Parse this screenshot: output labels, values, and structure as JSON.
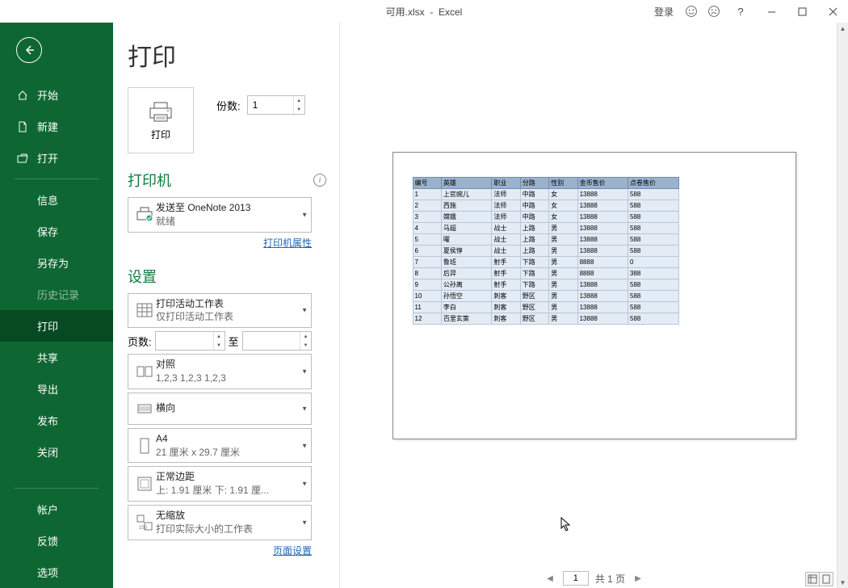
{
  "titlebar": {
    "filename": "可用.xlsx",
    "app": "Excel",
    "login": "登录",
    "help": "?"
  },
  "sidebar": {
    "start": "开始",
    "new": "新建",
    "open": "打开",
    "info": "信息",
    "save": "保存",
    "saveas": "另存为",
    "history": "历史记录",
    "print": "打印",
    "share": "共享",
    "export": "导出",
    "publish": "发布",
    "close": "关闭",
    "account": "帐户",
    "feedback": "反馈",
    "options": "选项"
  },
  "page": {
    "title": "打印",
    "copies_label": "份数:",
    "copies_value": "1",
    "print_button": "打印"
  },
  "printer": {
    "header": "打印机",
    "name": "发送至 OneNote 2013",
    "status": "就绪",
    "properties": "打印机属性"
  },
  "settings": {
    "header": "设置",
    "what": {
      "top": "打印活动工作表",
      "bot": "仅打印活动工作表"
    },
    "pages_label": "页数:",
    "pages_to": "至",
    "collate": {
      "top": "对照",
      "bot": "1,2,3    1,2,3    1,2,3"
    },
    "orientation": {
      "top": "横向"
    },
    "paper": {
      "top": "A4",
      "bot": "21 厘米 x 29.7 厘米"
    },
    "margins": {
      "top": "正常边距",
      "bot": "上: 1.91 厘米 下: 1.91 厘..."
    },
    "scaling": {
      "top": "无缩放",
      "bot": "打印实际大小的工作表"
    },
    "page_setup": "页面设置"
  },
  "preview": {
    "headers": [
      "编号",
      "英雄",
      "职业",
      "分路",
      "性别",
      "金币售价",
      "点卷售价"
    ],
    "rows": [
      [
        "1",
        "上官婉儿",
        "法师",
        "中路",
        "女",
        "13888",
        "588"
      ],
      [
        "2",
        "西施",
        "法师",
        "中路",
        "女",
        "13888",
        "588"
      ],
      [
        "3",
        "嫦娥",
        "法师",
        "中路",
        "女",
        "13888",
        "588"
      ],
      [
        "4",
        "马超",
        "战士",
        "上路",
        "男",
        "13888",
        "588"
      ],
      [
        "5",
        "曜",
        "战士",
        "上路",
        "男",
        "13888",
        "588"
      ],
      [
        "6",
        "夏侯惇",
        "战士",
        "上路",
        "男",
        "13888",
        "588"
      ],
      [
        "7",
        "鲁班",
        "射手",
        "下路",
        "男",
        "8888",
        "0"
      ],
      [
        "8",
        "后羿",
        "射手",
        "下路",
        "男",
        "8888",
        "388"
      ],
      [
        "9",
        "公孙离",
        "射手",
        "下路",
        "男",
        "13888",
        "588"
      ],
      [
        "10",
        "孙悟空",
        "刺客",
        "野区",
        "男",
        "13888",
        "588"
      ],
      [
        "11",
        "李白",
        "刺客",
        "野区",
        "男",
        "13888",
        "588"
      ],
      [
        "12",
        "百里玄策",
        "刺客",
        "野区",
        "男",
        "13888",
        "588"
      ]
    ]
  },
  "pagenav": {
    "current": "1",
    "total": "共 1 页"
  }
}
